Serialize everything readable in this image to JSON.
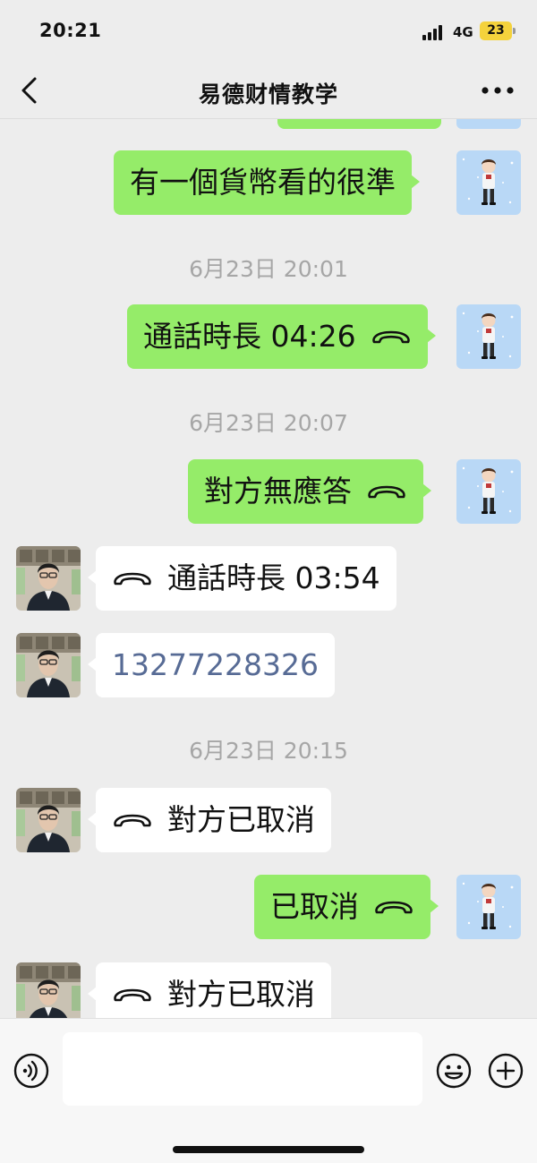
{
  "status_bar": {
    "time": "20:21",
    "network": "4G",
    "battery": "23"
  },
  "header": {
    "title": "易德财情教学"
  },
  "messages": [
    {
      "text": "有一個貨幣看的很準"
    },
    {
      "timestamp": "6月23日 20:01"
    },
    {
      "text": "通話時長 04:26"
    },
    {
      "timestamp": "6月23日 20:07"
    },
    {
      "text": "對方無應答"
    },
    {
      "text": "通話時長 03:54"
    },
    {
      "text": "13277228326"
    },
    {
      "timestamp": "6月23日 20:15"
    },
    {
      "text": "對方已取消"
    },
    {
      "text": "已取消"
    },
    {
      "text": "對方已取消"
    }
  ],
  "input": {
    "placeholder": ""
  },
  "colors": {
    "background": "#ededed",
    "outgoing_bubble": "#95ec69",
    "incoming_bubble": "#ffffff",
    "link": "#576b95",
    "timestamp": "#a6a6a6"
  },
  "icons": [
    "back-icon",
    "more-icon",
    "phone-icon",
    "voice-icon",
    "emoji-icon",
    "plus-icon"
  ]
}
